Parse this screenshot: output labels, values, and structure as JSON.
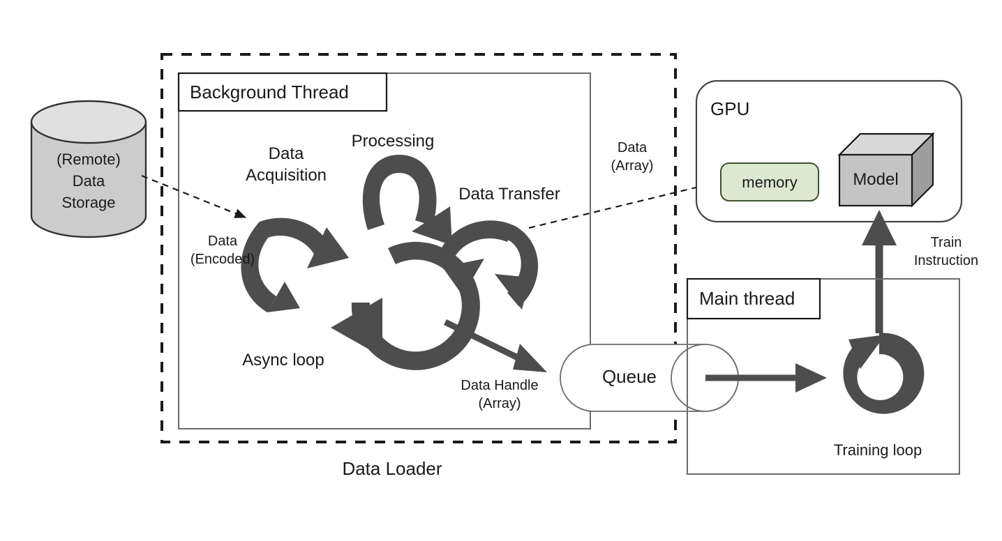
{
  "diagram": {
    "title": "Data Loader architecture",
    "colors": {
      "ink": "#1a1a1a",
      "arrow_gray": "#4d4d4d",
      "cylinder_fill": "#cccccc",
      "memory_fill": "#dde8d0",
      "memory_border": "#42562f",
      "model_front": "#c4c4c4",
      "model_top": "#d9d9d9",
      "model_side": "#9e9e9e",
      "box_stroke": "#6b6b6b",
      "dash_stroke": "#1a1a1a"
    }
  },
  "storage": {
    "line1": "(Remote)",
    "line2": "Data",
    "line3": "Storage"
  },
  "data_loader": {
    "caption": "Data Loader",
    "background_thread_label": "Background Thread"
  },
  "loop_labels": {
    "data_acquisition": "Data\nAcquisition",
    "processing": "Processing",
    "data_transfer": "Data Transfer",
    "async_loop": "Async loop",
    "data_encoded": "Data\n(Encoded)",
    "data_handle": "Data Handle\n(Array)"
  },
  "queue": {
    "label": "Queue"
  },
  "flows": {
    "data_array": "Data\n(Array)",
    "train_instruction": "Train\nInstruction"
  },
  "gpu": {
    "title": "GPU",
    "memory_label": "memory",
    "model_label": "Model"
  },
  "main_thread": {
    "title": "Main thread",
    "training_loop_label": "Training loop"
  }
}
